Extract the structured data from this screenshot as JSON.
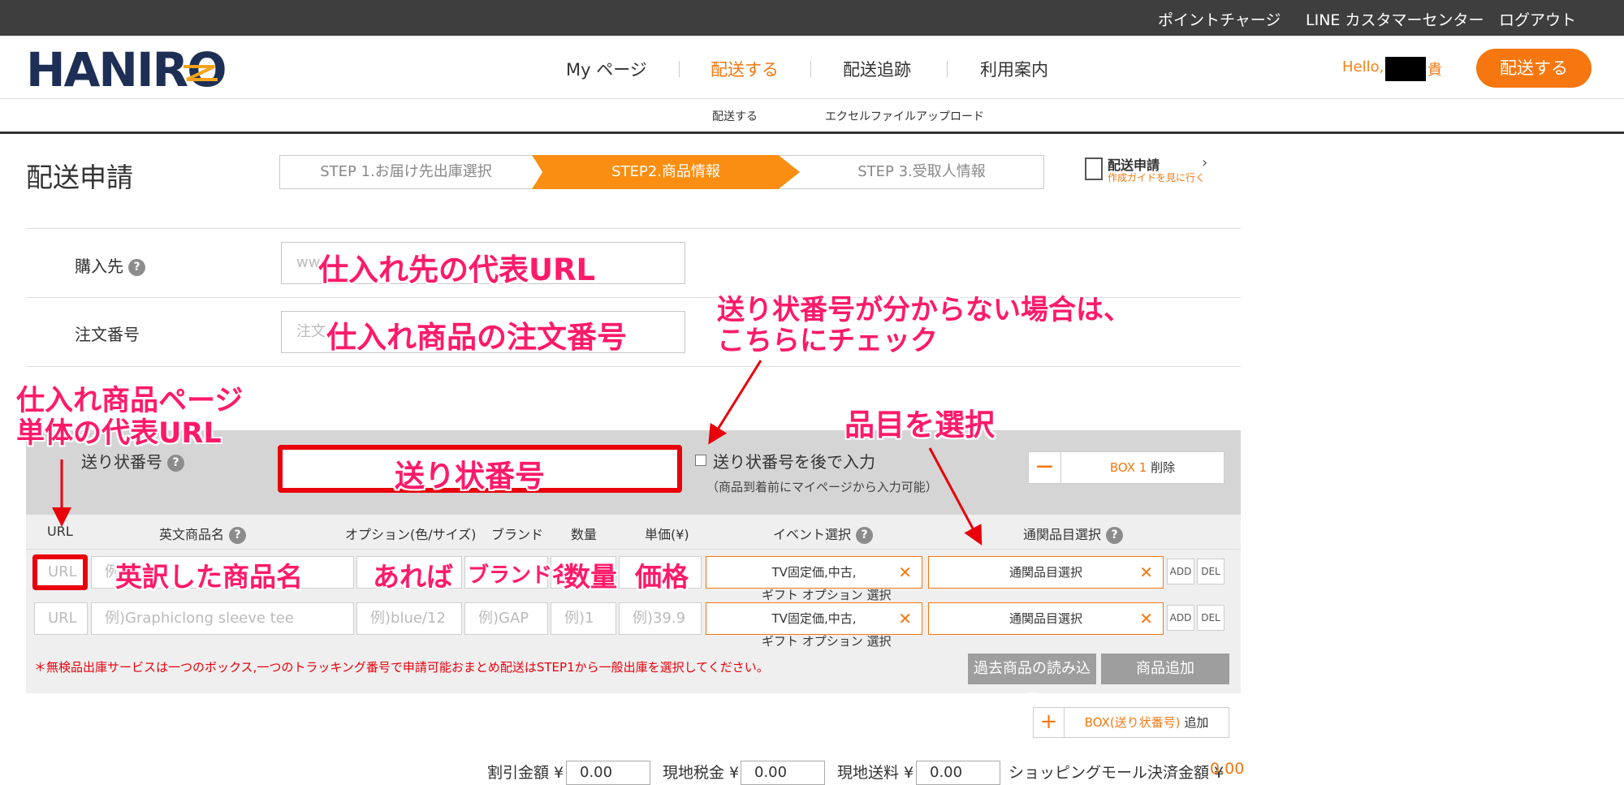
{
  "topbar": {
    "points": "ポイントチャージ",
    "line_center": "LINE カスタマーセンター",
    "logout": "ログアウト"
  },
  "header": {
    "logo": "HANIRO",
    "nav": [
      "My ページ",
      "配送する",
      "配送追跡",
      "利用案内"
    ],
    "hello": "Hello,",
    "hello_suffix": "貴",
    "cta": "配送する",
    "subnav": [
      "配送する",
      "エクセルファイルアップロード"
    ]
  },
  "page": {
    "title": "配送申請",
    "steps": [
      "STEP 1.お届け先出庫選択",
      "STEP2.商品情報",
      "STEP 3.受取人情報"
    ],
    "guide_title": "配送申請",
    "guide_sub": "作成ガイドを見に行く"
  },
  "form": {
    "purchase_label": "購入先",
    "purchase_placeholder": "ww",
    "order_label": "注文番号",
    "order_placeholder": "注文"
  },
  "box": {
    "tracking_label": "送り状番号",
    "later_label": "送り状番号を後で入力",
    "later_sub": "（商品到着前にマイページから入力可能）",
    "delete_prefix": "BOX 1",
    "delete_suffix": "削除"
  },
  "table": {
    "headers": [
      "URL",
      "英文商品名",
      "オプション(色/サイズ)",
      "ブランド",
      "数量",
      "単価(¥)",
      "イベント選択",
      "通関品目選択"
    ],
    "rows": [
      {
        "url": "URL",
        "name": "例",
        "option": "",
        "brand": "",
        "qty": "",
        "price": "",
        "event": "TV固定価,中古,",
        "event_sub": "ギフト オプション 選択",
        "customs": "通関品目選択"
      },
      {
        "url": "URL",
        "name": "例)Graphiclong sleeve tee",
        "option": "例)blue/12",
        "brand": "例)GAP",
        "qty": "例)1",
        "price": "例)39.9",
        "event": "TV固定価,中古,",
        "event_sub": "ギフト オプション 選択",
        "customs": "通関品目選択"
      }
    ],
    "add_label": "ADD",
    "del_label": "DEL",
    "note": "＊無検品出庫サービスは一つのボックス,一つのトラッキング番号で申請可能おまとめ配送はSTEP1から一般出庫を選択してください。",
    "past_button": "過去商品の読み込み",
    "add_item_button": "商品追加",
    "add_box_prefix": "BOX(送り状番号)",
    "add_box_suffix": "追加"
  },
  "totals": {
    "discount_label": "割引金額 ¥",
    "discount_value": "0.00",
    "local_tax_label": "現地税金 ¥",
    "local_tax_value": "0.00",
    "local_ship_label": "現地送料 ¥",
    "local_ship_value": "0.00",
    "mall_label": "ショッピングモール決済金額 ¥",
    "mall_value": "0.00"
  },
  "annotations": {
    "purchase": "仕入れ先の代表URL",
    "order": "仕入れ商品の注文番号",
    "tracking_unknown_1": "送り状番号が分からない場合は、",
    "tracking_unknown_2": "こちらにチェック",
    "item_url_1": "仕入れ商品ページ",
    "item_url_2": "単体の代表URL",
    "tracking": "送り状番号",
    "category": "品目を選択",
    "name": "英訳した商品名",
    "option": "あれば",
    "brand": "ブランド名",
    "qty": "数量",
    "price": "価格"
  },
  "colors": {
    "accent": "#f6770f",
    "annotation": "#ff1a6a",
    "highlight_box": "#e8000b",
    "topbar": "#3e3e3e"
  }
}
